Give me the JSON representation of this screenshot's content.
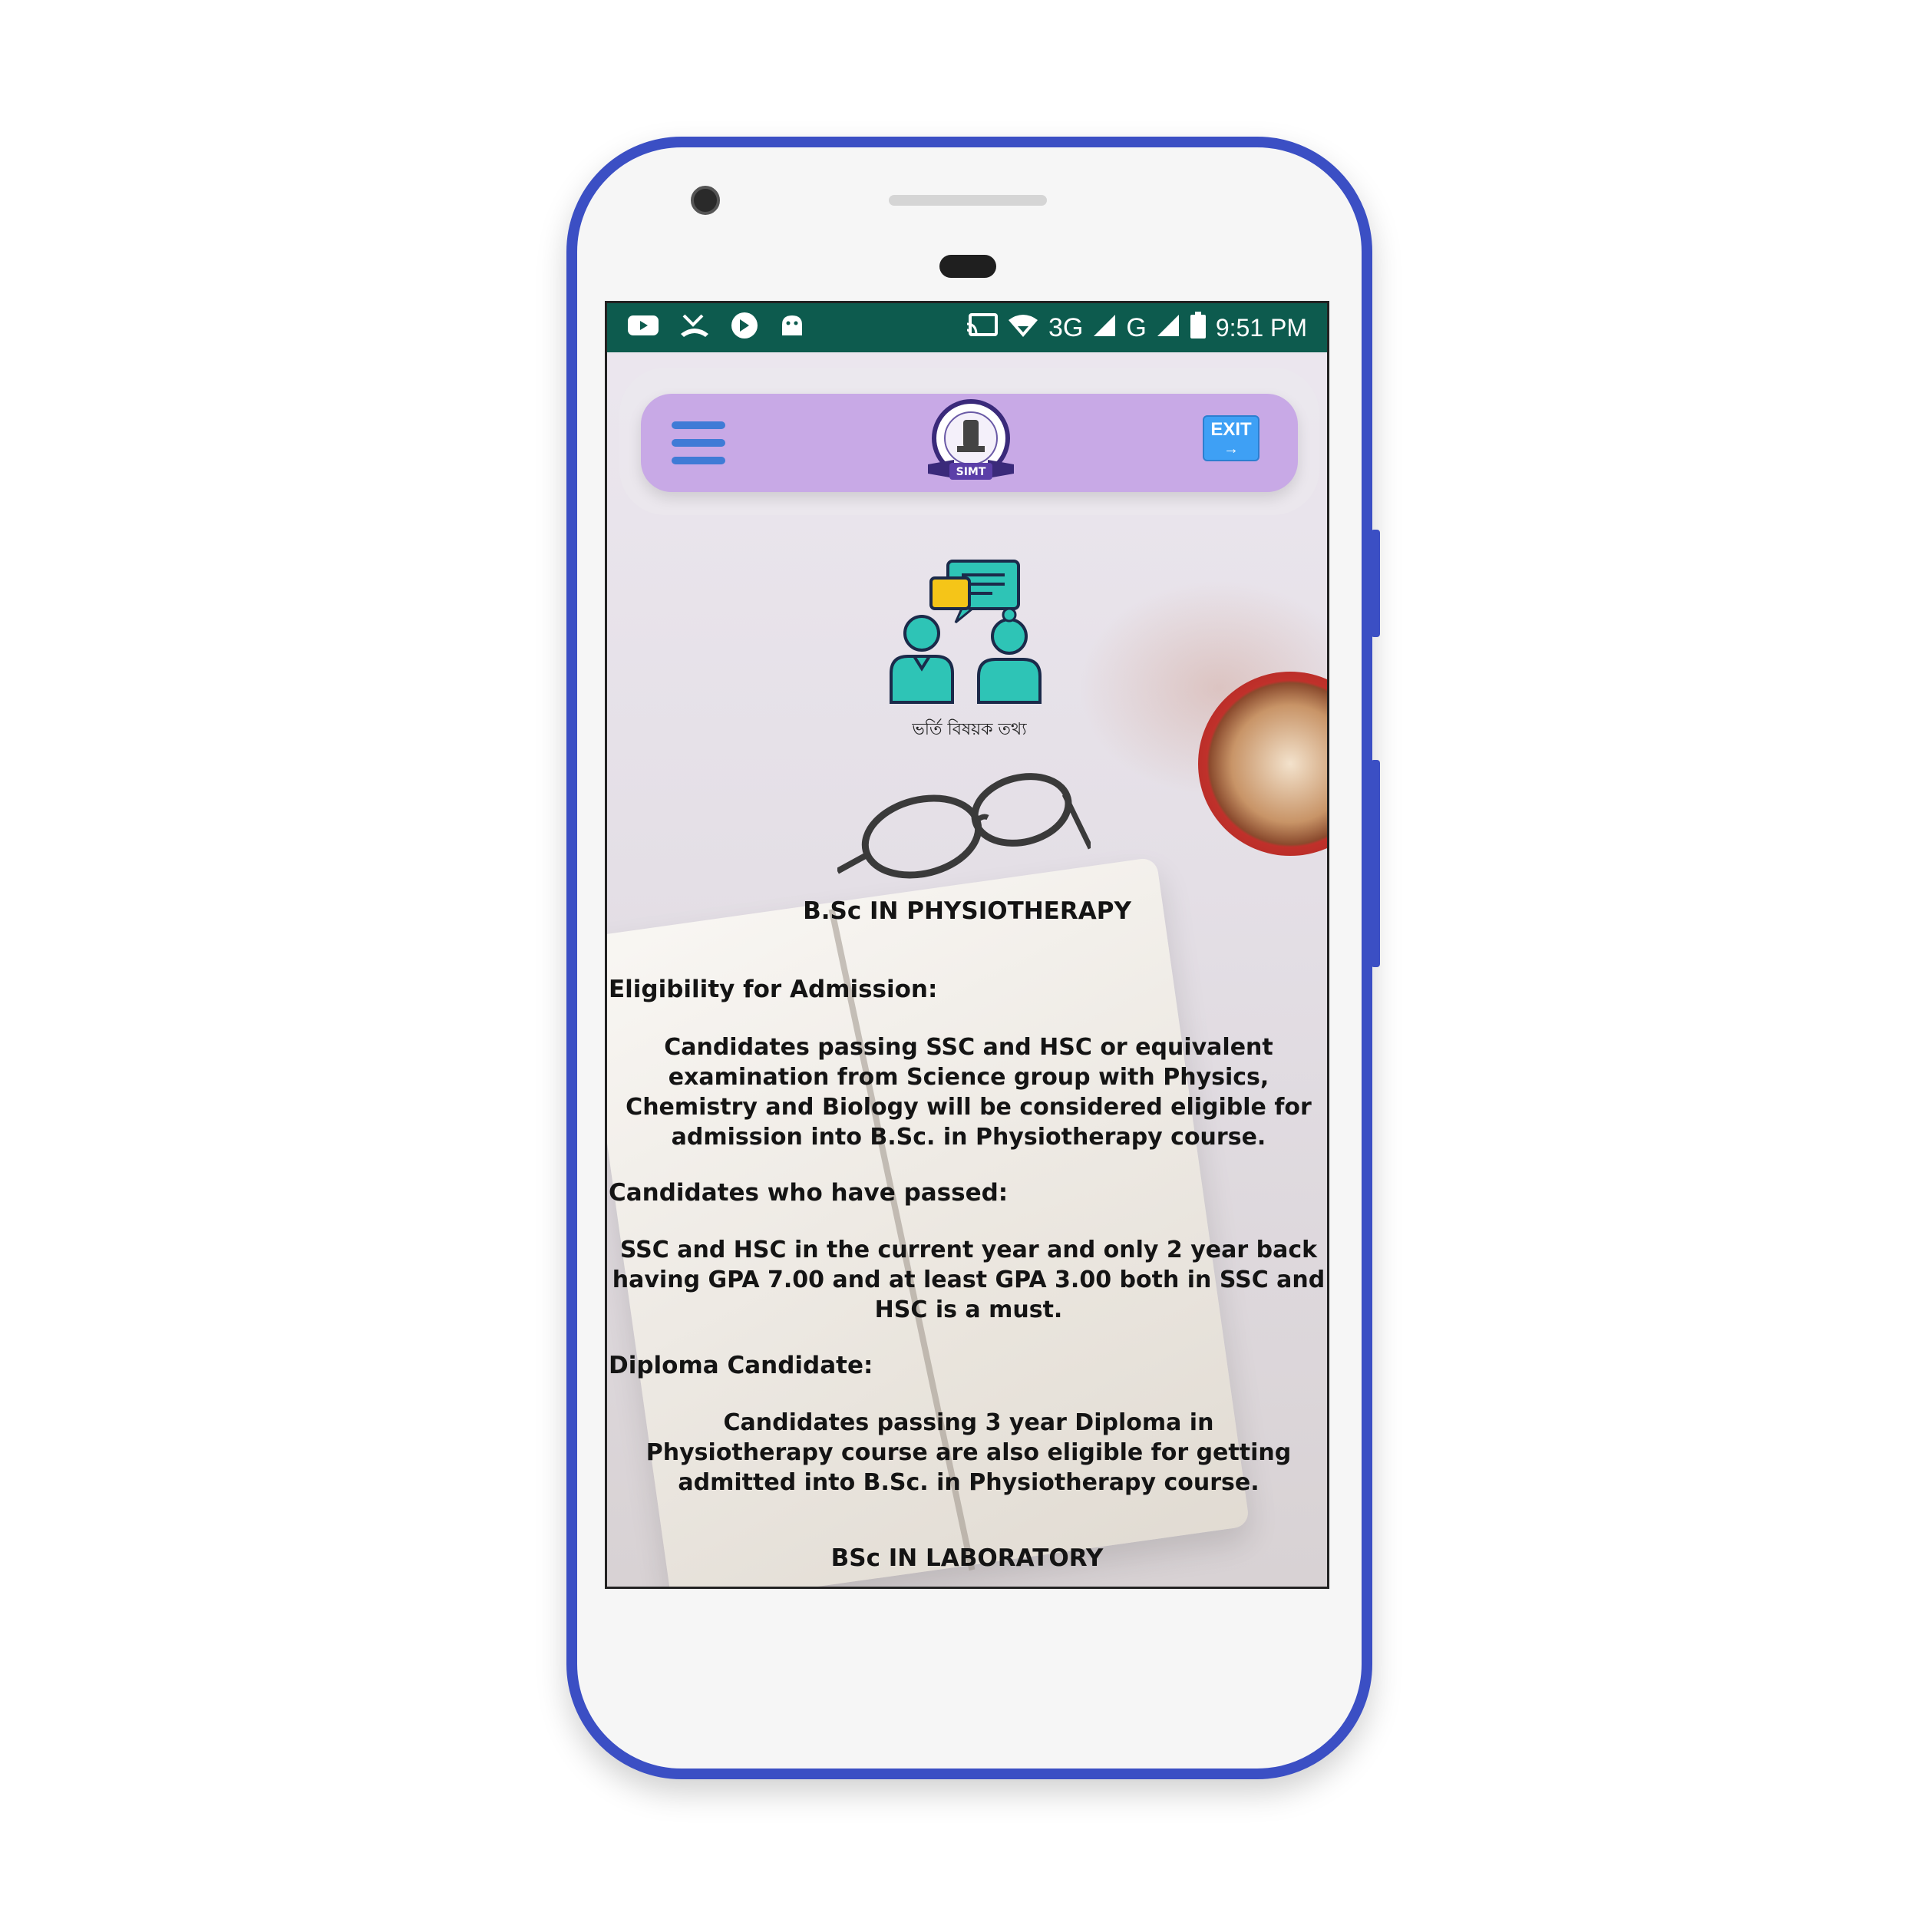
{
  "status_bar": {
    "left_icons": [
      "youtube-icon",
      "missed-call-icon",
      "shield-app-icon",
      "android-icon"
    ],
    "right_icons": [
      "cast-icon",
      "wifi-icon",
      "signal-icon",
      "roaming-signal-icon",
      "battery-icon"
    ],
    "network": "3G",
    "network_secondary": "G",
    "time": "9:51 PM"
  },
  "app_bar": {
    "logo_text": "SIMT",
    "exit_label": "EXIT",
    "background": "#c8a9e6"
  },
  "admission": {
    "caption": "ভর্তি বিষয়ক তথ্য"
  },
  "sections": {
    "physio_title": "B.Sc IN PHYSIOTHERAPY",
    "eligibility_heading": "Eligibility for Admission:",
    "eligibility_text": "Candidates passing SSC and HSC or equivalent examination from Science group with Physics, Chemistry and Biology will be considered eligible for admission into B.Sc. in Physiotherapy course.",
    "passed_heading": "Candidates who have passed:",
    "passed_text": "SSC and HSC in the current year and only 2 year back having GPA 7.00 and at least GPA 3.00 both in SSC and HSC is a must.",
    "diploma_heading": "Diploma Candidate:",
    "diploma_text": "Candidates passing 3 year Diploma in Physiotherapy course are also eligible for getting admitted into B.Sc. in Physiotherapy course.",
    "lab_title": "BSc IN LABORATORY"
  },
  "colors": {
    "status_bar": "#0d5b4e",
    "phone_frame": "#3b4fc4",
    "menu_icon": "#3f7bd6",
    "exit_button": "#3ea0f5"
  }
}
